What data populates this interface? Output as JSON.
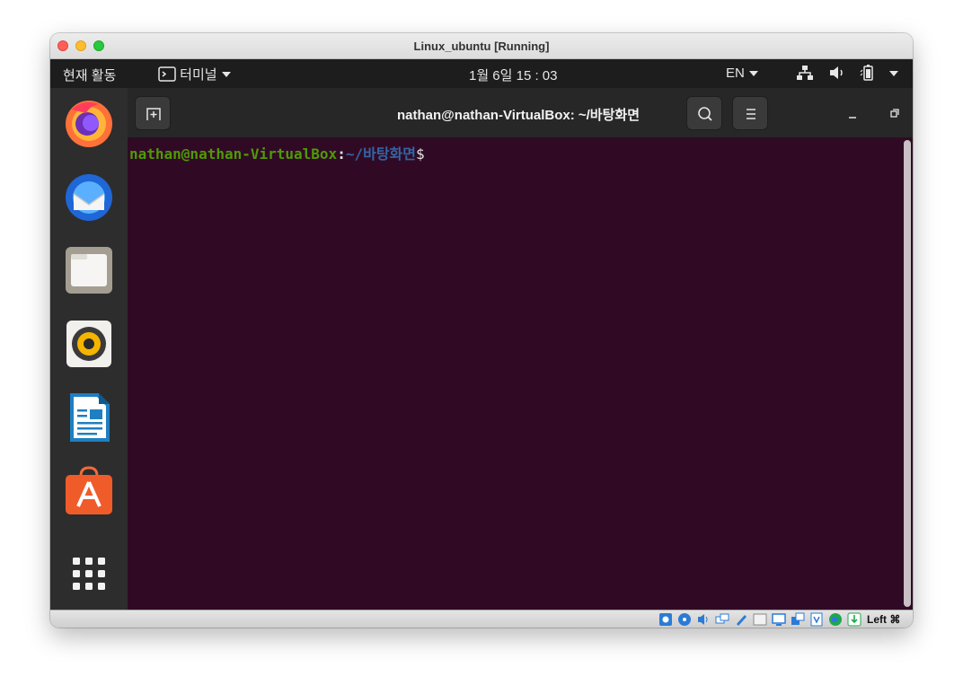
{
  "window": {
    "title": "Linux_ubuntu [Running]"
  },
  "topbar": {
    "activities": "현재 활동",
    "app_label": "터미널",
    "datetime": "1월 6일  15 : 03",
    "keyboard": "EN"
  },
  "dock": {
    "items": [
      "firefox",
      "thunderbird",
      "files",
      "rhythmbox",
      "libreoffice-writer",
      "ubuntu-software",
      "show-applications"
    ]
  },
  "terminal": {
    "title": "nathan@nathan-VirtualBox: ~/바탕화면",
    "prompt_user": "nathan@nathan-VirtualBox",
    "prompt_colon": ":",
    "prompt_path": "~/바탕화면",
    "prompt_dollar": "$"
  },
  "statusbar": {
    "host_key": "Left ⌘"
  },
  "colors": {
    "terminal_bg": "#300a24",
    "prompt_user": "#4e9a06",
    "prompt_path": "#3465a4",
    "close_button": "#e95420"
  }
}
